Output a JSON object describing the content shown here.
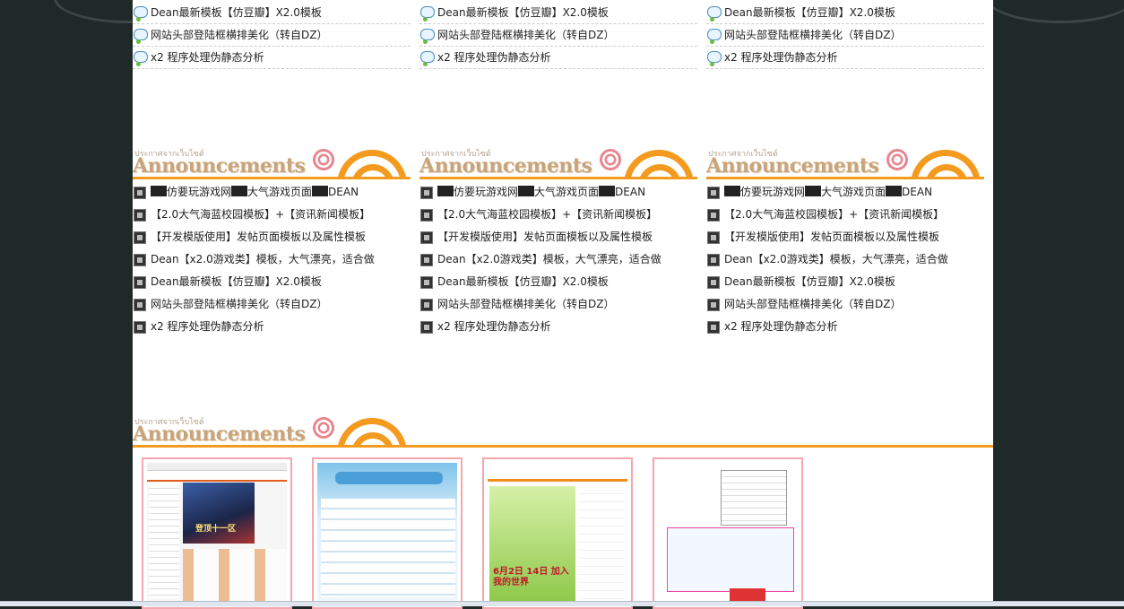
{
  "section_heading": {
    "thai": "ประกาศจากเว็บไซต์",
    "title": "Announcements"
  },
  "top_lists": [
    [
      "Dean最新模板【仿豆瓣】X2.0模板",
      "网站头部登陆框横排美化（转自DZ）",
      "x2 程序处理伪静态分析"
    ],
    [
      "Dean最新模板【仿豆瓣】X2.0模板",
      "网站头部登陆框横排美化（转自DZ）",
      "x2 程序处理伪静态分析"
    ],
    [
      "Dean最新模板【仿豆瓣】X2.0模板",
      "网站头部登陆框横排美化（转自DZ）",
      "x2 程序处理伪静态分析"
    ]
  ],
  "announcement_lists": [
    {
      "first_parts": [
        "仿要玩游戏网",
        "大气游戏页面",
        "DEAN"
      ],
      "items": [
        "【2.0大气海蓝校园模板】+【资讯新闻模板】",
        "【开发模版使用】发帖页面模板以及属性模板",
        "Dean【x2.0游戏类】模板，大气漂亮，适合做",
        "Dean最新模板【仿豆瓣】X2.0模板",
        "网站头部登陆框横排美化（转自DZ）",
        "x2 程序处理伪静态分析"
      ]
    },
    {
      "first_parts": [
        "仿要玩游戏网",
        "大气游戏页面",
        "DEAN"
      ],
      "items": [
        "【2.0大气海蓝校园模板】+【资讯新闻模板】",
        "【开发模版使用】发帖页面模板以及属性模板",
        "Dean【x2.0游戏类】模板，大气漂亮，适合做",
        "Dean最新模板【仿豆瓣】X2.0模板",
        "网站头部登陆框横排美化（转自DZ）",
        "x2 程序处理伪静态分析"
      ]
    },
    {
      "first_parts": [
        "仿要玩游戏网",
        "大气游戏页面",
        "DEAN"
      ],
      "items": [
        "【2.0大气海蓝校园模板】+【资讯新闻模板】",
        "【开发模版使用】发帖页面模板以及属性模板",
        "Dean【x2.0游戏类】模板，大气漂亮，适合做",
        "Dean最新模板【仿豆瓣】X2.0模板",
        "网站头部登陆框横排美化（转自DZ）",
        "x2 程序处理伪静态分析"
      ]
    }
  ],
  "thumbnail_texts": {
    "game_banner": "登顶十一区",
    "green_banner": "6月2日 14日 加入我的世界"
  },
  "colors": {
    "accent": "#f39a1f",
    "heading": "#c8a47c",
    "thumb_border": "#f4a7ad",
    "page_bg": "#1f2a28"
  }
}
